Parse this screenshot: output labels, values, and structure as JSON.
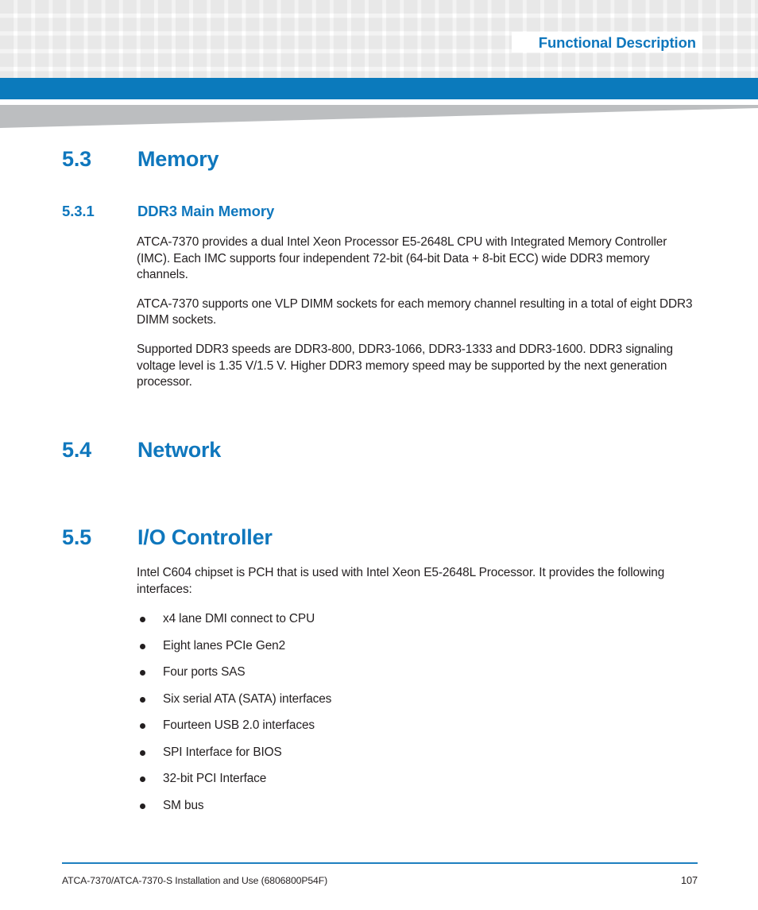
{
  "header": {
    "running_title": "Functional Description",
    "accent_color": "#0b7abc",
    "heading_color": "#0f77bd",
    "grid_square_color": "#f3f3f3",
    "wedge_color": "#bcbec0"
  },
  "sections": [
    {
      "number": "5.3",
      "title": "Memory",
      "level": 1
    },
    {
      "number": "5.3.1",
      "title": "DDR3 Main Memory",
      "level": 2,
      "paragraphs": [
        "ATCA-7370 provides a dual Intel Xeon Processor E5-2648L CPU with Integrated Memory Controller (IMC). Each IMC supports four independent 72-bit (64-bit Data + 8-bit ECC) wide DDR3 memory channels.",
        "ATCA-7370 supports one VLP DIMM sockets for each memory channel resulting in a total of eight DDR3 DIMM sockets.",
        "Supported DDR3 speeds are DDR3-800, DDR3-1066, DDR3-1333 and DDR3-1600. DDR3 signaling voltage level is 1.35 V/1.5 V. Higher DDR3 memory speed may be supported by the next generation processor."
      ]
    },
    {
      "number": "5.4",
      "title": "Network",
      "level": 1
    },
    {
      "number": "5.5",
      "title": "I/O Controller",
      "level": 1,
      "intro": "Intel C604 chipset is PCH that is used with Intel Xeon E5-2648L Processor. It provides the following interfaces:",
      "bullets": [
        "x4 lane DMI connect to CPU",
        "Eight lanes PCIe Gen2",
        "Four ports SAS",
        "Six serial ATA (SATA) interfaces",
        "Fourteen USB 2.0 interfaces",
        "SPI Interface for BIOS",
        "32-bit PCI Interface",
        "SM bus"
      ]
    }
  ],
  "footer": {
    "document_title": "ATCA-7370/ATCA-7370-S Installation and Use (6806800P54F)",
    "page_number": "107",
    "rule_color": "#1e7fc0"
  }
}
